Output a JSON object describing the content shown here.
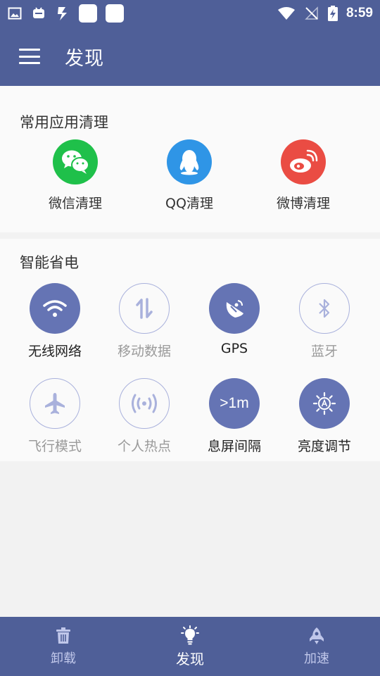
{
  "status_bar": {
    "time": "8:59",
    "left_icons": [
      "image-icon",
      "app-icon",
      "bolt-icon",
      "blank-box-icon",
      "blank-box-icon"
    ],
    "right_icons": [
      "wifi-icon",
      "no-signal-icon",
      "battery-charging-icon"
    ]
  },
  "app_bar": {
    "title": "发现"
  },
  "app_clean": {
    "title": "常用应用清理",
    "items": [
      {
        "label": "微信清理",
        "icon": "wechat-icon",
        "color": "#1fc04a"
      },
      {
        "label": "QQ清理",
        "icon": "qq-icon",
        "color": "#2f95e6"
      },
      {
        "label": "微博清理",
        "icon": "weibo-icon",
        "color": "#ea4c43"
      }
    ]
  },
  "power_save": {
    "title": "智能省电",
    "items": [
      {
        "label": "无线网络",
        "icon": "wifi-icon",
        "state": "on"
      },
      {
        "label": "移动数据",
        "icon": "mobile-data-icon",
        "state": "off"
      },
      {
        "label": "GPS",
        "icon": "gps-icon",
        "state": "on"
      },
      {
        "label": "蓝牙",
        "icon": "bluetooth-icon",
        "state": "off"
      },
      {
        "label": "飞行模式",
        "icon": "airplane-icon",
        "state": "off"
      },
      {
        "label": "个人热点",
        "icon": "hotspot-icon",
        "state": "off"
      },
      {
        "label": "息屏间隔",
        "icon": "screen-timeout-icon",
        "state": "on",
        "value": ">1m"
      },
      {
        "label": "亮度调节",
        "icon": "brightness-auto-icon",
        "state": "on"
      }
    ]
  },
  "bottom_nav": {
    "items": [
      {
        "label": "卸载",
        "icon": "trash-icon",
        "active": false
      },
      {
        "label": "发现",
        "icon": "bulb-icon",
        "active": true
      },
      {
        "label": "加速",
        "icon": "rocket-icon",
        "active": false
      }
    ]
  },
  "colors": {
    "primary": "#4f5f98",
    "toggle_on": "#6574b4",
    "toggle_off_border": "#a9b1dc",
    "inactive_nav": "#c0c7ea"
  }
}
